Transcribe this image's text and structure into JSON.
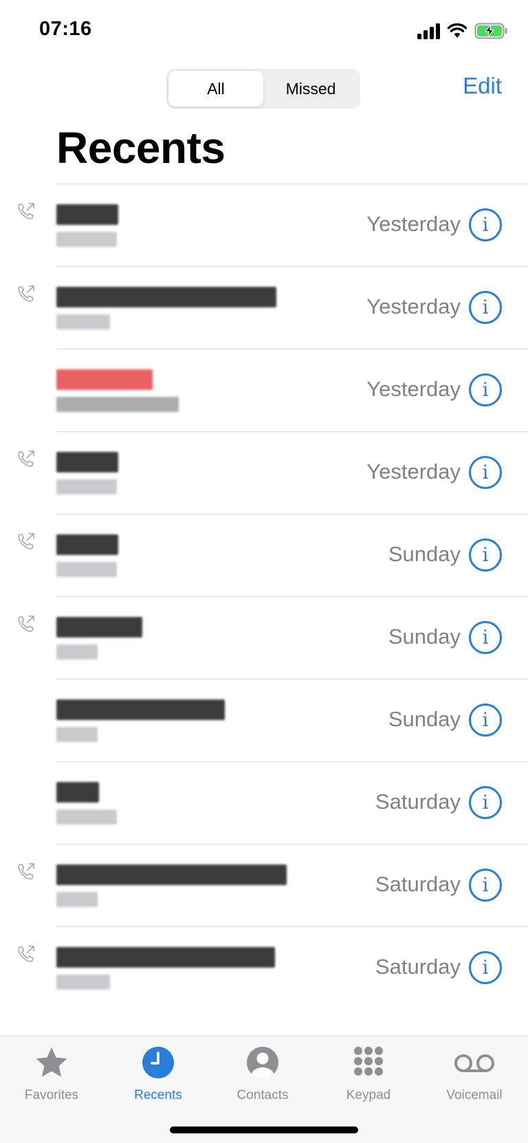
{
  "status_bar": {
    "time": "07:16",
    "icons": [
      "cellular-signal-icon",
      "wifi-icon",
      "battery-charging-icon"
    ]
  },
  "nav": {
    "segments": [
      "All",
      "Missed"
    ],
    "selected_segment": "All",
    "edit_label": "Edit"
  },
  "page_title": "Recents",
  "colors": {
    "accent": "#2a7ed6",
    "missed_call": "#e5383b",
    "secondary_text": "#808085",
    "tab_inactive": "#8e8e93"
  },
  "calls": [
    {
      "date": "Yesterday",
      "outgoing": true,
      "missed": false
    },
    {
      "date": "Yesterday",
      "outgoing": true,
      "missed": false
    },
    {
      "date": "Yesterday",
      "outgoing": false,
      "missed": true
    },
    {
      "date": "Yesterday",
      "outgoing": true,
      "missed": false
    },
    {
      "date": "Sunday",
      "outgoing": true,
      "missed": false
    },
    {
      "date": "Sunday",
      "outgoing": true,
      "missed": false
    },
    {
      "date": "Sunday",
      "outgoing": false,
      "missed": false
    },
    {
      "date": "Saturday",
      "outgoing": false,
      "missed": false
    },
    {
      "date": "Saturday",
      "outgoing": true,
      "missed": false
    },
    {
      "date": "Saturday",
      "outgoing": true,
      "missed": false
    }
  ],
  "info_glyph": "i",
  "tabs": [
    {
      "label": "Favorites",
      "icon": "star-icon",
      "active": false
    },
    {
      "label": "Recents",
      "icon": "clock-icon",
      "active": true
    },
    {
      "label": "Contacts",
      "icon": "person-circle-icon",
      "active": false
    },
    {
      "label": "Keypad",
      "icon": "keypad-icon",
      "active": false
    },
    {
      "label": "Voicemail",
      "icon": "voicemail-icon",
      "active": false
    }
  ]
}
